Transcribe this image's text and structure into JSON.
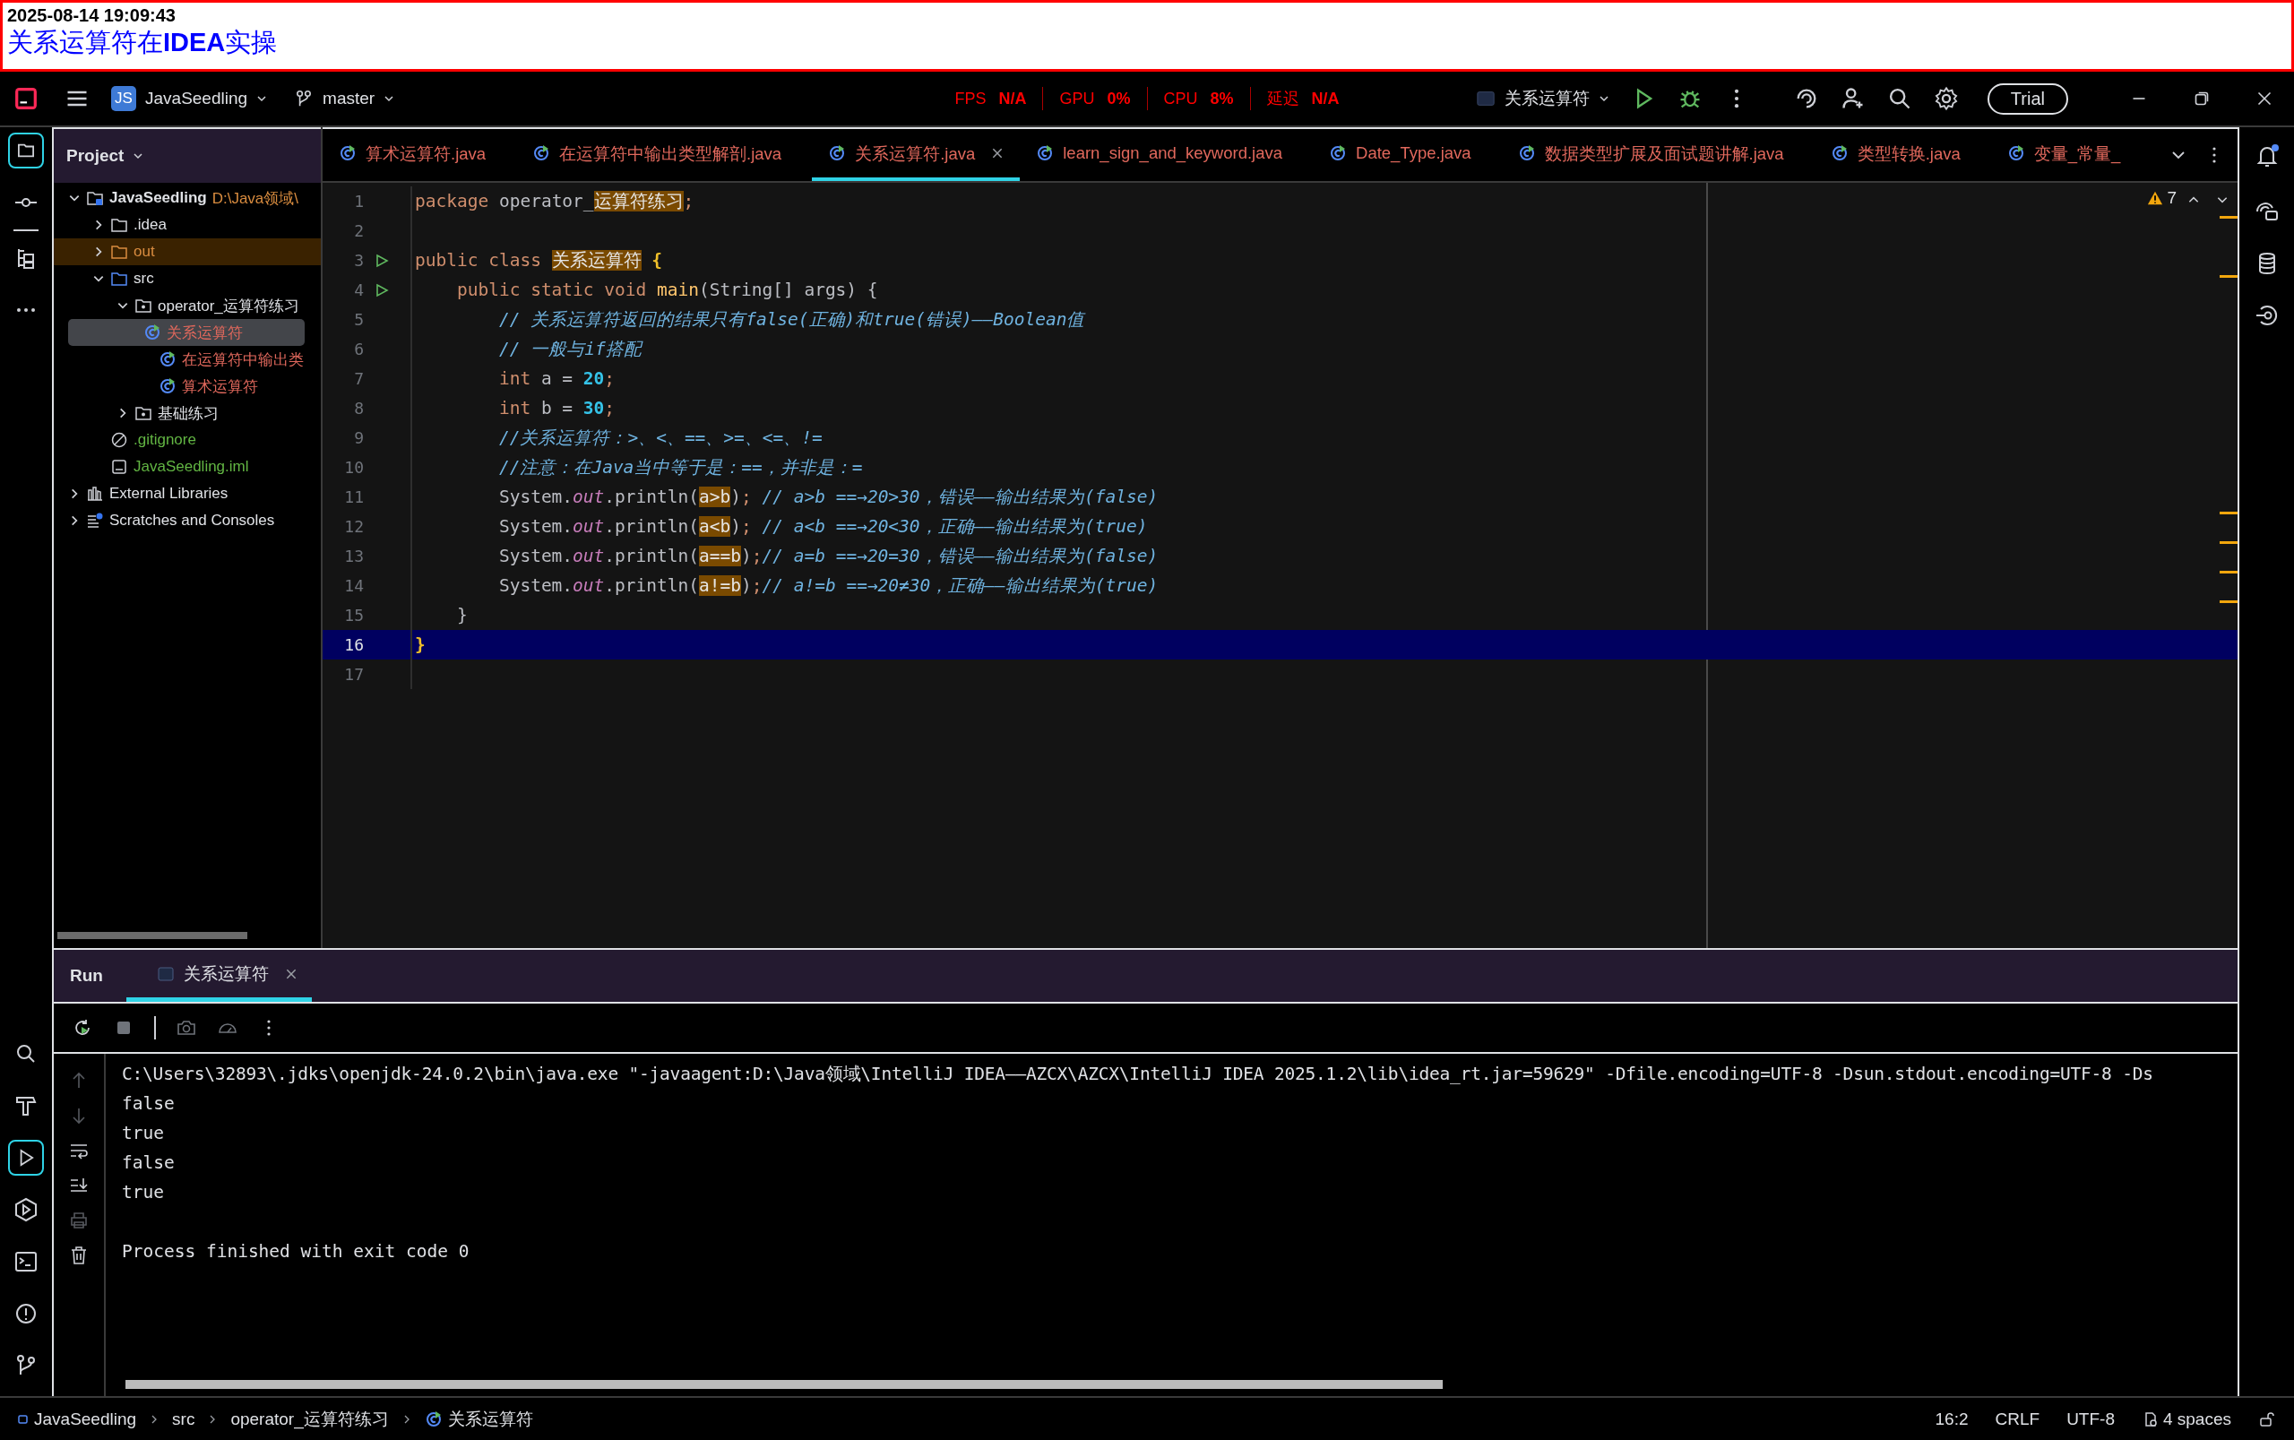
{
  "banner": {
    "timestamp": "2025-08-14 19:09:43",
    "title": "关系运算符在**IDEA**实操"
  },
  "title_bar": {
    "project_badge": "JS",
    "project": "JavaSeedling",
    "branch": "master",
    "metrics": [
      {
        "label": "FPS",
        "value": "N/A"
      },
      {
        "label": "GPU",
        "value": "0%"
      },
      {
        "label": "CPU",
        "value": "8%"
      },
      {
        "label": "延迟",
        "value": "N/A"
      }
    ],
    "run_configuration": "关系运算符",
    "trial_button": "Trial"
  },
  "project_panel": {
    "title": "Project",
    "tree": [
      {
        "label": "JavaSeedling",
        "path": "D:\\Java领域\\",
        "kind": "module",
        "color": "#dfe1e5",
        "expanded": true,
        "selected": false,
        "children": [
          {
            "label": ".idea",
            "kind": "folder",
            "color": "#dfe1e5",
            "expanded": false,
            "selected": false
          },
          {
            "label": "out",
            "kind": "excluded-folder",
            "color": "#d98c3f",
            "expanded": false,
            "selected": false
          },
          {
            "label": "src",
            "kind": "source-folder",
            "color": "#dfe1e5",
            "expanded": true,
            "selected": false,
            "children": [
              {
                "label": "operator_运算符练习",
                "kind": "package",
                "color": "#dfe1e5",
                "expanded": true,
                "selected": false,
                "children": [
                  {
                    "label": "关系运算符",
                    "kind": "class",
                    "color": "#e0685c",
                    "selected": true
                  },
                  {
                    "label": "在运算符中输出类",
                    "kind": "class",
                    "color": "#e0685c",
                    "selected": false
                  },
                  {
                    "label": "算术运算符",
                    "kind": "class",
                    "color": "#e0685c",
                    "selected": false
                  }
                ]
              },
              {
                "label": "基础练习",
                "kind": "package",
                "color": "#dfe1e5",
                "expanded": false,
                "selected": false
              }
            ]
          },
          {
            "label": ".gitignore",
            "kind": "ignore-file",
            "color": "#62b543",
            "selected": false
          },
          {
            "label": "JavaSeedling.iml",
            "kind": "module-file",
            "color": "#62b543",
            "selected": false
          }
        ]
      },
      {
        "label": "External Libraries",
        "kind": "library",
        "color": "#dfe1e5",
        "expanded": false,
        "selected": false
      },
      {
        "label": "Scratches and Consoles",
        "kind": "scratches",
        "color": "#dfe1e5",
        "expanded": false,
        "selected": false
      }
    ]
  },
  "editor_tabs": [
    {
      "label": "算术运算符.java",
      "selected": false
    },
    {
      "label": "在运算符中输出类型解剖.java",
      "selected": false
    },
    {
      "label": "关系运算符.java",
      "selected": true
    },
    {
      "label": "learn_sign_and_keyword.java",
      "selected": false
    },
    {
      "label": "Date_Type.java",
      "selected": false
    },
    {
      "label": "数据类型扩展及面试题讲解.java",
      "selected": false
    },
    {
      "label": "类型转换.java",
      "selected": false
    },
    {
      "label": "变量_常量_",
      "selected": false
    }
  ],
  "editor": {
    "warnings": "7",
    "lines": [
      {
        "number": "1",
        "run_marker": false,
        "current": false,
        "tokens": [
          {
            "text": "package",
            "kind": "keyword"
          },
          {
            "text": " operator_",
            "kind": "plain"
          },
          {
            "text": "运算符练习",
            "kind": "hl"
          },
          {
            "text": ";",
            "kind": "keyword"
          }
        ]
      },
      {
        "number": "2",
        "run_marker": false,
        "current": false
      },
      {
        "number": "3",
        "run_marker": true,
        "current": false,
        "tokens": [
          {
            "text": "public class ",
            "kind": "keyword"
          },
          {
            "text": "关系运算符",
            "kind": "hl"
          },
          {
            "text": " {",
            "kind": "brace"
          }
        ]
      },
      {
        "number": "4",
        "run_marker": true,
        "current": false,
        "tokens": [
          {
            "text": "    public static void ",
            "kind": "keyword"
          },
          {
            "text": "main",
            "kind": "method"
          },
          {
            "text": "(String[] args) {",
            "kind": "plain"
          }
        ]
      },
      {
        "number": "5",
        "run_marker": false,
        "current": false,
        "tokens": [
          {
            "text": "        // 关系运算符返回的结果只有false(正确)和true(错误)——Boolean值",
            "kind": "comment"
          }
        ]
      },
      {
        "number": "6",
        "run_marker": false,
        "current": false,
        "tokens": [
          {
            "text": "        // 一般与if搭配",
            "kind": "comment"
          }
        ]
      },
      {
        "number": "7",
        "run_marker": false,
        "current": false,
        "tokens": [
          {
            "text": "        int",
            "kind": "keyword"
          },
          {
            "text": " a = ",
            "kind": "plain"
          },
          {
            "text": "20",
            "kind": "number"
          },
          {
            "text": ";",
            "kind": "keyword"
          }
        ]
      },
      {
        "number": "8",
        "run_marker": false,
        "current": false,
        "tokens": [
          {
            "text": "        int",
            "kind": "keyword"
          },
          {
            "text": " b = ",
            "kind": "plain"
          },
          {
            "text": "30",
            "kind": "number"
          },
          {
            "text": ";",
            "kind": "keyword"
          }
        ]
      },
      {
        "number": "9",
        "run_marker": false,
        "current": false,
        "tokens": [
          {
            "text": "        //关系运算符：>、<、==、>=、<=、!=",
            "kind": "comment"
          }
        ]
      },
      {
        "number": "10",
        "run_marker": false,
        "current": false,
        "tokens": [
          {
            "text": "        //注意：在Java当中等于是：==，并非是：=",
            "kind": "comment"
          }
        ]
      },
      {
        "number": "11",
        "run_marker": false,
        "current": false,
        "tokens": [
          {
            "text": "        System.",
            "kind": "plain"
          },
          {
            "text": "out",
            "kind": "field"
          },
          {
            "text": ".println(",
            "kind": "plain"
          },
          {
            "text": "a>b",
            "kind": "hl"
          },
          {
            "text": ")",
            "kind": "plain"
          },
          {
            "text": ";",
            "kind": "keyword"
          },
          {
            "text": " // a>b ==→20>30，错误——输出结果为(false)",
            "kind": "comment"
          }
        ]
      },
      {
        "number": "12",
        "run_marker": false,
        "current": false,
        "tokens": [
          {
            "text": "        System.",
            "kind": "plain"
          },
          {
            "text": "out",
            "kind": "field"
          },
          {
            "text": ".println(",
            "kind": "plain"
          },
          {
            "text": "a<b",
            "kind": "hl"
          },
          {
            "text": ")",
            "kind": "plain"
          },
          {
            "text": ";",
            "kind": "keyword"
          },
          {
            "text": " // a<b ==→20<30，正确——输出结果为(true)",
            "kind": "comment"
          }
        ]
      },
      {
        "number": "13",
        "run_marker": false,
        "current": false,
        "tokens": [
          {
            "text": "        System.",
            "kind": "plain"
          },
          {
            "text": "out",
            "kind": "field"
          },
          {
            "text": ".println(",
            "kind": "plain"
          },
          {
            "text": "a==b",
            "kind": "hl"
          },
          {
            "text": ")",
            "kind": "plain"
          },
          {
            "text": ";",
            "kind": "keyword"
          },
          {
            "text": "// a=b ==→20=30，错误——输出结果为(false)",
            "kind": "comment"
          }
        ]
      },
      {
        "number": "14",
        "run_marker": false,
        "current": false,
        "tokens": [
          {
            "text": "        System.",
            "kind": "plain"
          },
          {
            "text": "out",
            "kind": "field"
          },
          {
            "text": ".println(",
            "kind": "plain"
          },
          {
            "text": "a!=b",
            "kind": "hl"
          },
          {
            "text": ")",
            "kind": "plain"
          },
          {
            "text": ";",
            "kind": "keyword"
          },
          {
            "text": "// a!=b ==→20≠30，正确——输出结果为(true)",
            "kind": "comment"
          }
        ]
      },
      {
        "number": "15",
        "run_marker": false,
        "current": false,
        "tokens": [
          {
            "text": "    }",
            "kind": "plain"
          }
        ]
      },
      {
        "number": "16",
        "run_marker": false,
        "current": true,
        "tokens": [
          {
            "text": "}",
            "kind": "brace"
          }
        ]
      },
      {
        "number": "17",
        "run_marker": false,
        "current": false
      }
    ]
  },
  "run_panel": {
    "title": "Run",
    "tabs": [
      {
        "label": "关系运算符",
        "selected": true
      }
    ],
    "console": [
      {
        "text": "C:\\Users\\32893\\.jdks\\openjdk-24.0.2\\bin\\java.exe \"-javaagent:D:\\Java领域\\IntelliJ IDEA——AZCX\\AZCX\\IntelliJ IDEA 2025.1.2\\lib\\idea_rt.jar=59629\" -Dfile.encoding=UTF-8 -Dsun.stdout.encoding=UTF-8 -Ds",
        "kind": "command"
      },
      {
        "text": "false",
        "kind": "output"
      },
      {
        "text": "true",
        "kind": "output"
      },
      {
        "text": "false",
        "kind": "output"
      },
      {
        "text": "true",
        "kind": "output"
      },
      {
        "text": "Process finished with exit code 0",
        "kind": "exit"
      }
    ]
  },
  "status_bar": {
    "breadcrumbs": [
      {
        "label": "JavaSeedling",
        "kind": "module"
      },
      {
        "label": "src",
        "kind": "folder"
      },
      {
        "label": "operator_运算符练习",
        "kind": "package"
      },
      {
        "label": "关系运算符",
        "kind": "class"
      }
    ],
    "position": "16:2",
    "line_separator": "CRLF",
    "encoding": "UTF-8",
    "indent": "4 spaces"
  }
}
